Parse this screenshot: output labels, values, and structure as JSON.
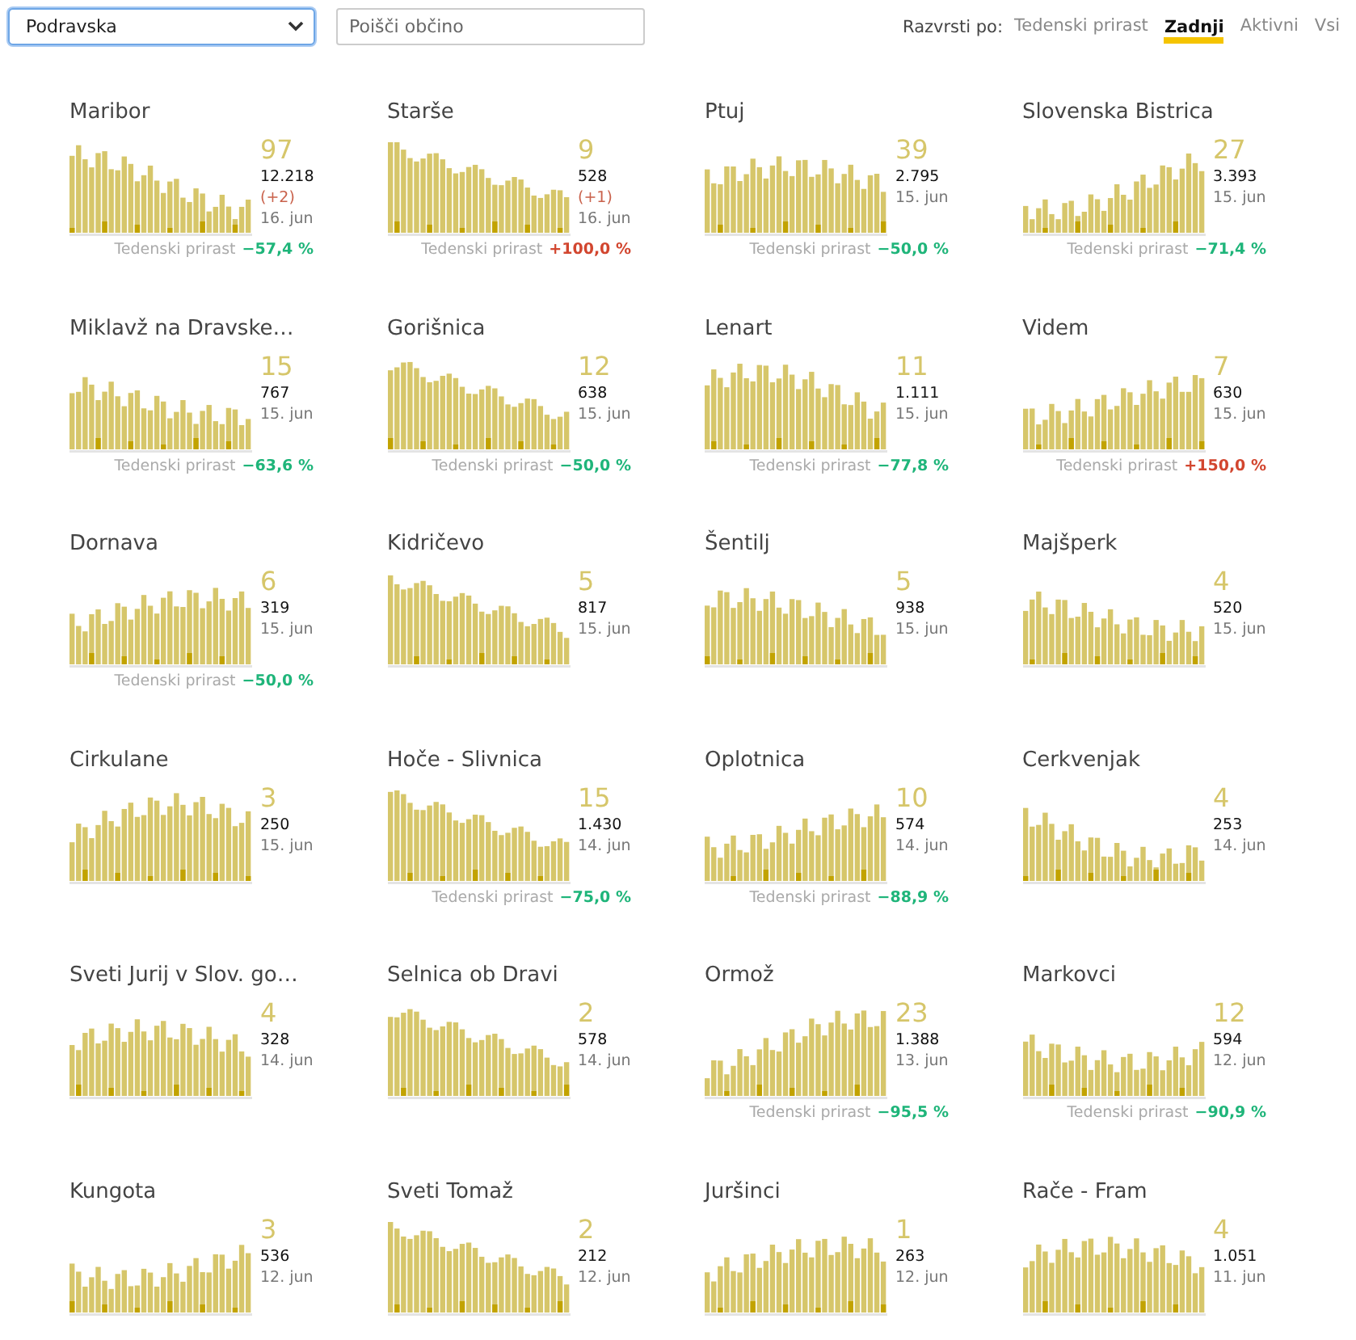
{
  "region_select": {
    "value": "Podravska"
  },
  "search": {
    "placeholder": "Poišči občino"
  },
  "sort": {
    "label": "Razvrsti po:",
    "options": [
      {
        "label": "Tedenski prirast",
        "selected": false
      },
      {
        "label": "Zadnji",
        "selected": true
      },
      {
        "label": "Aktivni",
        "selected": false
      },
      {
        "label": "Vsi",
        "selected": false
      }
    ]
  },
  "cards": [
    {
      "name": "Maribor",
      "active": "97",
      "total": "12.218",
      "delta": "(+2)",
      "date": "16. jun",
      "growth": {
        "label": "Tedenski prirast",
        "value": "−57,4 %",
        "color": "#1fb57a"
      }
    },
    {
      "name": "Starše",
      "active": "9",
      "total": "528",
      "delta": "(+1)",
      "date": "16. jun",
      "growth": {
        "label": "Tedenski prirast",
        "value": "+100,0 %",
        "color": "#d2462f"
      }
    },
    {
      "name": "Ptuj",
      "active": "39",
      "total": "2.795",
      "date": "15. jun",
      "growth": {
        "label": "Tedenski prirast",
        "value": "−50,0 %",
        "color": "#1fb57a"
      }
    },
    {
      "name": "Slovenska Bistrica",
      "active": "27",
      "total": "3.393",
      "date": "15. jun",
      "growth": {
        "label": "Tedenski prirast",
        "value": "−71,4 %",
        "color": "#1fb57a"
      }
    },
    {
      "name": "Miklavž na Dravske…",
      "active": "15",
      "total": "767",
      "date": "15. jun",
      "growth": {
        "label": "Tedenski prirast",
        "value": "−63,6 %",
        "color": "#1fb57a"
      }
    },
    {
      "name": "Gorišnica",
      "active": "12",
      "total": "638",
      "date": "15. jun",
      "growth": {
        "label": "Tedenski prirast",
        "value": "−50,0 %",
        "color": "#1fb57a"
      }
    },
    {
      "name": "Lenart",
      "active": "11",
      "total": "1.111",
      "date": "15. jun",
      "growth": {
        "label": "Tedenski prirast",
        "value": "−77,8 %",
        "color": "#1fb57a"
      }
    },
    {
      "name": "Videm",
      "active": "7",
      "total": "630",
      "date": "15. jun",
      "growth": {
        "label": "Tedenski prirast",
        "value": "+150,0 %",
        "color": "#d2462f"
      }
    },
    {
      "name": "Dornava",
      "active": "6",
      "total": "319",
      "date": "15. jun",
      "growth": {
        "label": "Tedenski prirast",
        "value": "−50,0 %",
        "color": "#1fb57a"
      }
    },
    {
      "name": "Kidričevo",
      "active": "5",
      "total": "817",
      "date": "15. jun"
    },
    {
      "name": "Šentilj",
      "active": "5",
      "total": "938",
      "date": "15. jun"
    },
    {
      "name": "Majšperk",
      "active": "4",
      "total": "520",
      "date": "15. jun"
    },
    {
      "name": "Cirkulane",
      "active": "3",
      "total": "250",
      "date": "15. jun"
    },
    {
      "name": "Hoče - Slivnica",
      "active": "15",
      "total": "1.430",
      "date": "14. jun",
      "growth": {
        "label": "Tedenski prirast",
        "value": "−75,0 %",
        "color": "#1fb57a"
      }
    },
    {
      "name": "Oplotnica",
      "active": "10",
      "total": "574",
      "date": "14. jun",
      "growth": {
        "label": "Tedenski prirast",
        "value": "−88,9 %",
        "color": "#1fb57a"
      }
    },
    {
      "name": "Cerkvenjak",
      "active": "4",
      "total": "253",
      "date": "14. jun"
    },
    {
      "name": "Sveti Jurij v Slov. go…",
      "active": "4",
      "total": "328",
      "date": "14. jun"
    },
    {
      "name": "Selnica ob Dravi",
      "active": "2",
      "total": "578",
      "date": "14. jun"
    },
    {
      "name": "Ormož",
      "active": "23",
      "total": "1.388",
      "date": "13. jun",
      "growth": {
        "label": "Tedenski prirast",
        "value": "−95,5 %",
        "color": "#1fb57a"
      }
    },
    {
      "name": "Markovci",
      "active": "12",
      "total": "594",
      "date": "12. jun",
      "growth": {
        "label": "Tedenski prirast",
        "value": "−90,9 %",
        "color": "#1fb57a"
      }
    },
    {
      "name": "Kungota",
      "active": "3",
      "total": "536",
      "date": "12. jun"
    },
    {
      "name": "Sveti Tomaž",
      "active": "2",
      "total": "212",
      "date": "12. jun"
    },
    {
      "name": "Juršinci",
      "active": "1",
      "total": "263",
      "date": "12. jun"
    },
    {
      "name": "Rače - Fram",
      "active": "4",
      "total": "1.051",
      "date": "11. jun"
    }
  ]
}
